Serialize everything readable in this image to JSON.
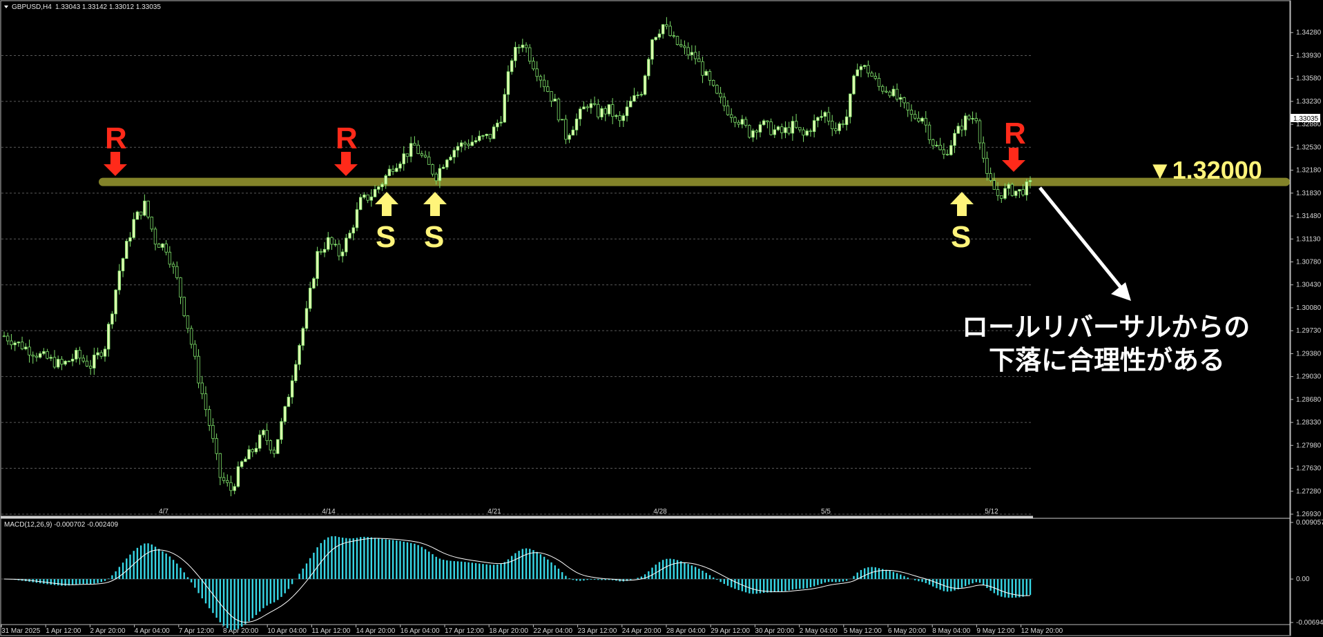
{
  "header": {
    "symbol": "GBPUSD,H4",
    "ohlc": "1.33043 1.33142 1.33012 1.33035"
  },
  "macd_header": "MACD(12,26,9) -0.000702 -0.002409",
  "current_price_label": "1.33035",
  "level_label": "▼1.32000",
  "note_lines": [
    "ロールリバーサルからの",
    "下落に合理性がある"
  ],
  "markers": {
    "resistance": "R",
    "support": "S"
  },
  "colors": {
    "background": "#000000",
    "bull_candle": "#dfffb0",
    "bear_candle": "#000000",
    "candle_outline": "#7ee06a",
    "macd_hist": "#37d7e6",
    "signal_line": "#ffffff",
    "level_band": "#9a9a30",
    "resistance_marker": "#ff2a1a",
    "support_marker": "#fff47a",
    "grid": "#5a5a5a"
  },
  "chart_data": [
    {
      "type": "candlestick",
      "symbol": "GBPUSD",
      "timeframe": "H4",
      "y_ticks": [
        "1.34280",
        "1.33930",
        "1.33580",
        "1.33230",
        "1.32880",
        "1.32530",
        "1.32180",
        "1.31830",
        "1.31480",
        "1.31130",
        "1.30780",
        "1.30430",
        "1.30080",
        "1.29730",
        "1.29380",
        "1.29030",
        "1.28680",
        "1.28330",
        "1.27980",
        "1.27630",
        "1.27280",
        "1.26930"
      ],
      "ylim": [
        1.2693,
        1.3463
      ],
      "x_ticks": [
        "31 Mar 2025",
        "1 Apr 12:00",
        "2 Apr 20:00",
        "4 Apr 04:00",
        "7 Apr 12:00",
        "8 Apr 20:00",
        "10 Apr 04:00",
        "11 Apr 12:00",
        "14 Apr 20:00",
        "16 Apr 04:00",
        "17 Apr 12:00",
        "18 Apr 20:00",
        "22 Apr 04:00",
        "23 Apr 12:00",
        "24 Apr 20:00",
        "28 Apr 04:00",
        "29 Apr 12:00",
        "30 Apr 20:00",
        "2 May 04:00",
        "5 May 12:00",
        "6 May 20:00",
        "8 May 04:00",
        "9 May 12:00",
        "12 May 20:00"
      ],
      "week_labels": [
        "4/7",
        "4/14",
        "4/21",
        "4/28",
        "5/5",
        "5/12"
      ],
      "key_level": 1.32,
      "close_path": [
        [
          0,
          1.2965
        ],
        [
          10,
          1.2935
        ],
        [
          16,
          1.292
        ],
        [
          20,
          1.2935
        ],
        [
          24,
          1.292
        ],
        [
          28,
          1.295
        ],
        [
          32,
          1.3065
        ],
        [
          36,
          1.314
        ],
        [
          39,
          1.3165
        ],
        [
          42,
          1.311
        ],
        [
          45,
          1.31
        ],
        [
          48,
          1.305
        ],
        [
          51,
          1.298
        ],
        [
          54,
          1.29
        ],
        [
          57,
          1.283
        ],
        [
          60,
          1.275
        ],
        [
          63,
          1.273
        ],
        [
          66,
          1.277
        ],
        [
          69,
          1.279
        ],
        [
          72,
          1.2815
        ],
        [
          75,
          1.279
        ],
        [
          78,
          1.285
        ],
        [
          81,
          1.293
        ],
        [
          84,
          1.3
        ],
        [
          87,
          1.309
        ],
        [
          90,
          1.311
        ],
        [
          93,
          1.309
        ],
        [
          96,
          1.312
        ],
        [
          99,
          1.317
        ],
        [
          102,
          1.318
        ],
        [
          105,
          1.32
        ],
        [
          108,
          1.3225
        ],
        [
          111,
          1.324
        ],
        [
          114,
          1.3255
        ],
        [
          117,
          1.323
        ],
        [
          120,
          1.321
        ],
        [
          123,
          1.324
        ],
        [
          126,
          1.3255
        ],
        [
          129,
          1.326
        ],
        [
          132,
          1.3265
        ],
        [
          135,
          1.327
        ],
        [
          138,
          1.33
        ],
        [
          141,
          1.339
        ],
        [
          144,
          1.3415
        ],
        [
          147,
          1.338
        ],
        [
          150,
          1.335
        ],
        [
          153,
          1.332
        ],
        [
          156,
          1.327
        ],
        [
          159,
          1.3295
        ],
        [
          162,
          1.332
        ],
        [
          165,
          1.3305
        ],
        [
          168,
          1.331
        ],
        [
          171,
          1.329
        ],
        [
          174,
          1.332
        ],
        [
          177,
          1.334
        ],
        [
          180,
          1.342
        ],
        [
          183,
          1.344
        ],
        [
          186,
          1.3415
        ],
        [
          189,
          1.34
        ],
        [
          192,
          1.339
        ],
        [
          195,
          1.336
        ],
        [
          198,
          1.333
        ],
        [
          201,
          1.331
        ],
        [
          204,
          1.3295
        ],
        [
          207,
          1.3275
        ],
        [
          210,
          1.329
        ],
        [
          213,
          1.328
        ],
        [
          216,
          1.3275
        ],
        [
          219,
          1.3285
        ],
        [
          222,
          1.327
        ],
        [
          225,
          1.329
        ],
        [
          228,
          1.3305
        ],
        [
          231,
          1.328
        ],
        [
          234,
          1.33
        ],
        [
          237,
          1.338
        ],
        [
          240,
          1.337
        ],
        [
          243,
          1.3345
        ],
        [
          246,
          1.334
        ],
        [
          249,
          1.332
        ],
        [
          252,
          1.33
        ],
        [
          255,
          1.33
        ],
        [
          258,
          1.326
        ],
        [
          261,
          1.324
        ],
        [
          264,
          1.327
        ],
        [
          267,
          1.3295
        ],
        [
          270,
          1.33
        ],
        [
          273,
          1.3205
        ],
        [
          276,
          1.318
        ],
        [
          279,
          1.3188
        ],
        [
          282,
          1.3185
        ],
        [
          285,
          1.3195
        ]
      ],
      "indicator": {
        "name": "MACD(12,26,9)",
        "macd": -0.000702,
        "signal": -0.002409,
        "y_ticks": [
          "0.009057",
          "0.00",
          "-0.006949"
        ],
        "ylim": [
          -0.006949,
          0.009057
        ]
      }
    }
  ]
}
